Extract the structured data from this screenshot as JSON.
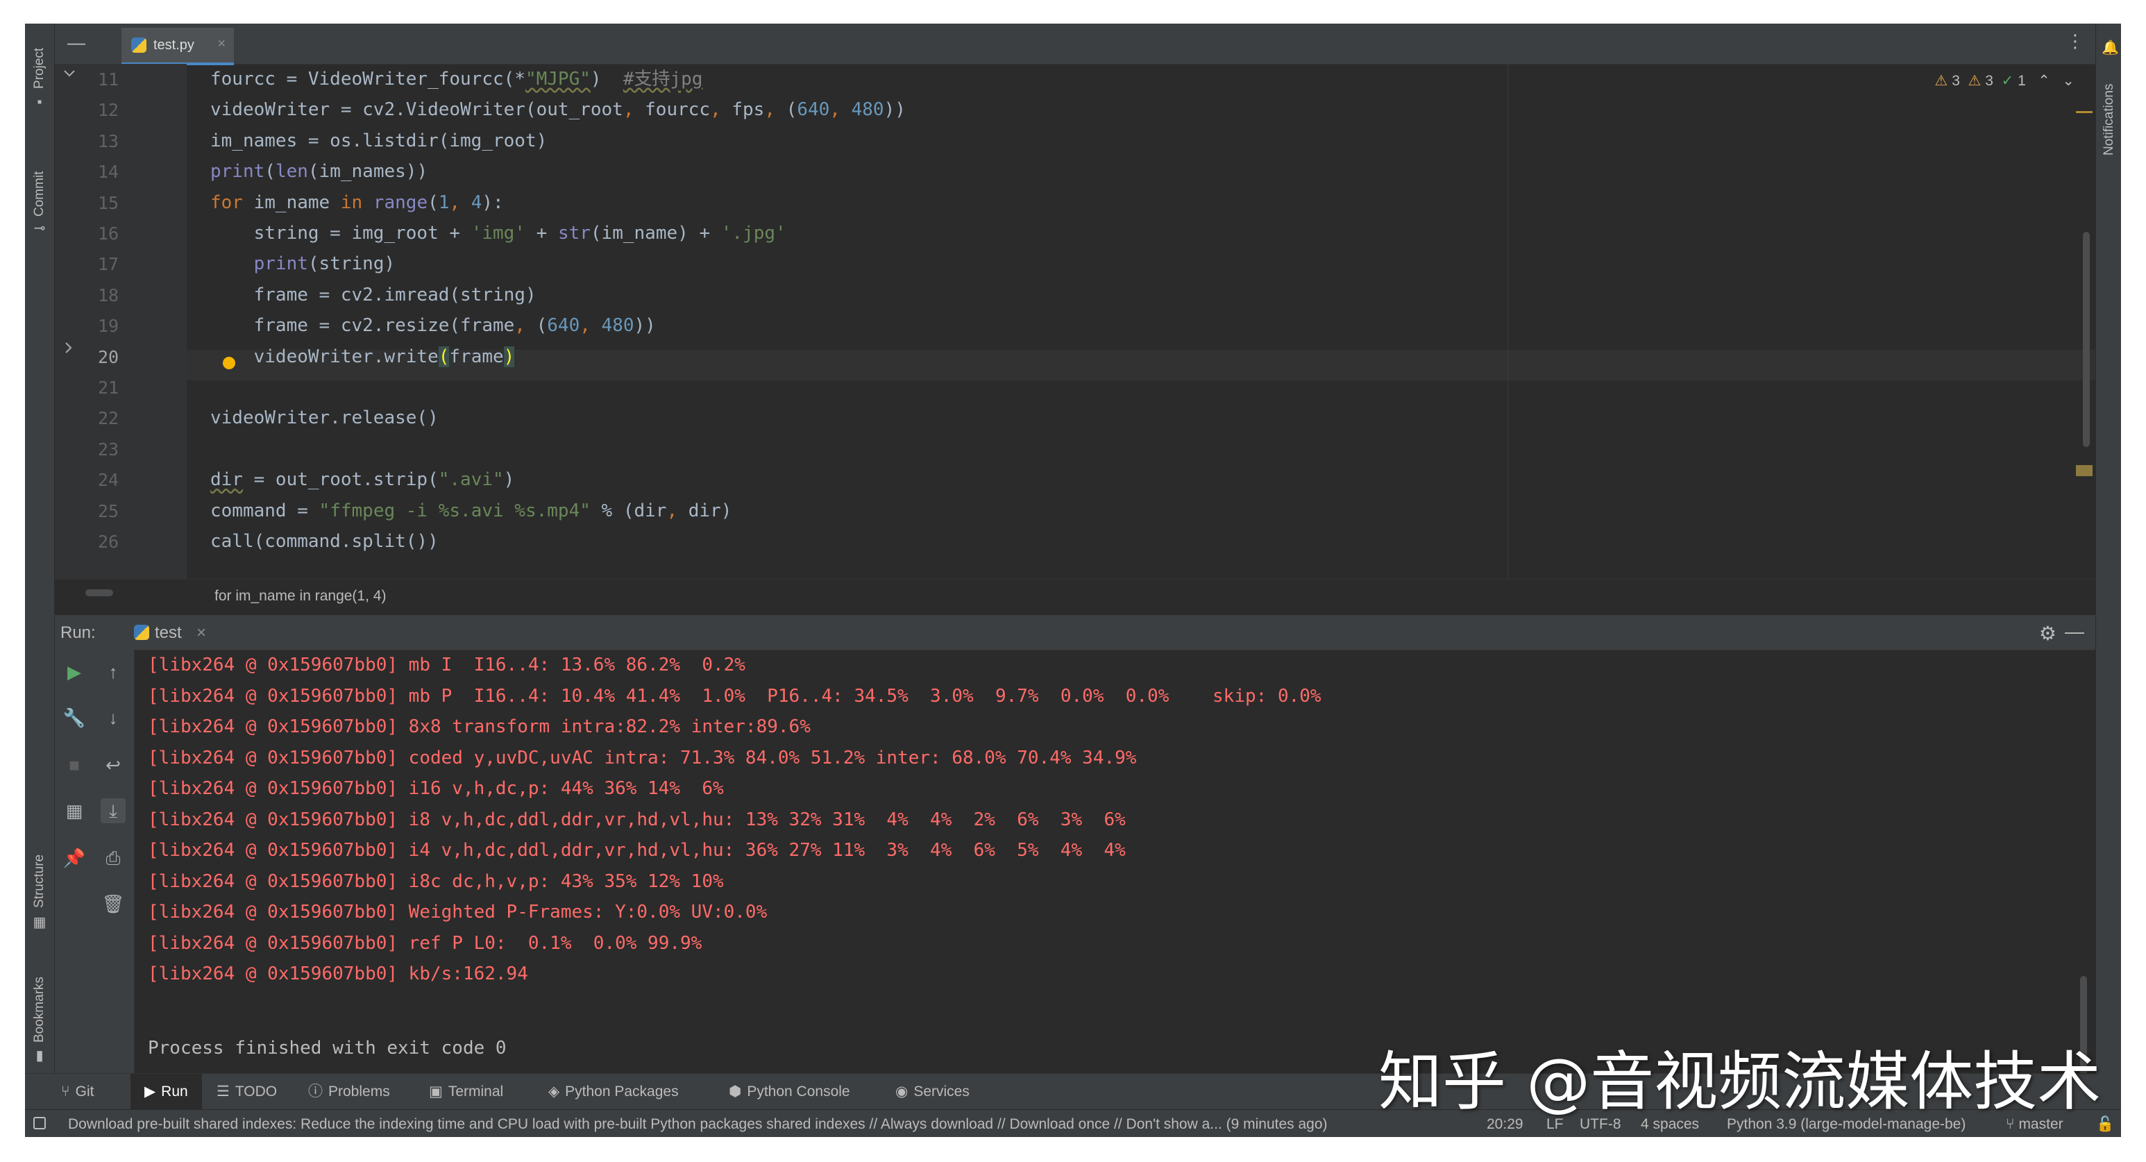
{
  "left_strip": {
    "project": "Project",
    "commit": "Commit",
    "structure": "Structure",
    "bookmarks": "Bookmarks"
  },
  "right_strip": {
    "notifications": "Notifications"
  },
  "editor": {
    "tab_label": "test.py",
    "inspections": {
      "warnings": "3",
      "weak_warnings": "3",
      "typos": "1"
    },
    "line_numbers": [
      "11",
      "12",
      "13",
      "14",
      "15",
      "16",
      "17",
      "18",
      "19",
      "20",
      "21",
      "22",
      "23",
      "24",
      "25",
      "26"
    ],
    "code_lines": [
      [
        [
          "plain",
          "fourcc = VideoWriter_fourcc(*"
        ],
        [
          "str und",
          "\"MJPG\""
        ],
        [
          "plain",
          ")  "
        ],
        [
          "cm und",
          "#支持jpg"
        ]
      ],
      [
        [
          "plain",
          "videoWriter = cv2.VideoWriter(out_root"
        ],
        [
          "kw",
          ", "
        ],
        [
          "plain",
          "fourcc"
        ],
        [
          "kw",
          ", "
        ],
        [
          "plain",
          "fps"
        ],
        [
          "kw",
          ", "
        ],
        [
          "plain",
          "("
        ],
        [
          "num",
          "640"
        ],
        [
          "kw",
          ", "
        ],
        [
          "num",
          "480"
        ],
        [
          "plain",
          "))"
        ]
      ],
      [
        [
          "plain",
          "im_names = os.listdir(img_root)"
        ]
      ],
      [
        [
          "bi",
          "print"
        ],
        [
          "plain",
          "("
        ],
        [
          "bi",
          "len"
        ],
        [
          "plain",
          "(im_names))"
        ]
      ],
      [
        [
          "kw",
          "for "
        ],
        [
          "plain",
          "im_name "
        ],
        [
          "kw",
          "in "
        ],
        [
          "bi",
          "range"
        ],
        [
          "plain",
          "("
        ],
        [
          "num",
          "1"
        ],
        [
          "kw",
          ", "
        ],
        [
          "num",
          "4"
        ],
        [
          "plain",
          "):"
        ]
      ],
      [
        [
          "plain",
          "    string = img_root + "
        ],
        [
          "str",
          "'img'"
        ],
        [
          "plain",
          " + "
        ],
        [
          "bi",
          "str"
        ],
        [
          "plain",
          "(im_name) + "
        ],
        [
          "str",
          "'.jpg'"
        ]
      ],
      [
        [
          "plain",
          "    "
        ],
        [
          "bi",
          "print"
        ],
        [
          "plain",
          "(string)"
        ]
      ],
      [
        [
          "plain",
          "    frame = cv2.imread(string)"
        ]
      ],
      [
        [
          "plain",
          "    frame = cv2.resize(frame"
        ],
        [
          "kw",
          ", "
        ],
        [
          "plain",
          "("
        ],
        [
          "num",
          "640"
        ],
        [
          "kw",
          ", "
        ],
        [
          "num",
          "480"
        ],
        [
          "plain",
          "))"
        ]
      ],
      [
        [
          "plain",
          "    videoWriter.write"
        ],
        [
          "match",
          "("
        ],
        [
          "plain",
          "frame"
        ],
        [
          "match",
          ")"
        ]
      ],
      [
        [
          "plain",
          ""
        ]
      ],
      [
        [
          "plain",
          "videoWriter.release()"
        ]
      ],
      [
        [
          "plain",
          ""
        ]
      ],
      [
        [
          "plain und",
          "dir"
        ],
        [
          "plain",
          " = out_root.strip("
        ],
        [
          "str",
          "\".avi\""
        ],
        [
          "plain",
          ")"
        ]
      ],
      [
        [
          "plain",
          "command = "
        ],
        [
          "str",
          "\"ffmpeg -i %s.avi %s.mp4\""
        ],
        [
          "plain",
          " % (dir"
        ],
        [
          "kw",
          ", "
        ],
        [
          "plain",
          "dir)"
        ]
      ],
      [
        [
          "plain",
          "call(command.split())"
        ]
      ]
    ],
    "breadcrumb": "for im_name in range(1, 4)"
  },
  "run": {
    "label": "Run:",
    "tab": "test",
    "console_lines": [
      "[libx264 @ 0x159607bb0] mb I  I16..4: 13.6% 86.2%  0.2%",
      "[libx264 @ 0x159607bb0] mb P  I16..4: 10.4% 41.4%  1.0%  P16..4: 34.5%  3.0%  9.7%  0.0%  0.0%    skip: 0.0%",
      "[libx264 @ 0x159607bb0] 8x8 transform intra:82.2% inter:89.6%",
      "[libx264 @ 0x159607bb0] coded y,uvDC,uvAC intra: 71.3% 84.0% 51.2% inter: 68.0% 70.4% 34.9%",
      "[libx264 @ 0x159607bb0] i16 v,h,dc,p: 44% 36% 14%  6%",
      "[libx264 @ 0x159607bb0] i8 v,h,dc,ddl,ddr,vr,hd,vl,hu: 13% 32% 31%  4%  4%  2%  6%  3%  6%",
      "[libx264 @ 0x159607bb0] i4 v,h,dc,ddl,ddr,vr,hd,vl,hu: 36% 27% 11%  3%  4%  6%  5%  4%  4%",
      "[libx264 @ 0x159607bb0] i8c dc,h,v,p: 43% 35% 12% 10%",
      "[libx264 @ 0x159607bb0] Weighted P-Frames: Y:0.0% UV:0.0%",
      "[libx264 @ 0x159607bb0] ref P L0:  0.1%  0.0% 99.9%",
      "[libx264 @ 0x159607bb0] kb/s:162.94"
    ],
    "finish": "Process finished with exit code 0"
  },
  "bottom_tabs": [
    {
      "name": "git",
      "label": "Git",
      "icon": "branch-icon"
    },
    {
      "name": "run",
      "label": "Run",
      "icon": "play-icon"
    },
    {
      "name": "todo",
      "label": "TODO",
      "icon": "list-icon"
    },
    {
      "name": "problems",
      "label": "Problems",
      "icon": "info-icon"
    },
    {
      "name": "terminal",
      "label": "Terminal",
      "icon": "terminal-icon"
    },
    {
      "name": "python-packages",
      "label": "Python Packages",
      "icon": "layers-icon"
    },
    {
      "name": "python-console",
      "label": "Python Console",
      "icon": "python-icon"
    },
    {
      "name": "services",
      "label": "Services",
      "icon": "services-icon"
    }
  ],
  "status": {
    "message": "Download pre-built shared indexes: Reduce the indexing time and CPU load with pre-built Python packages shared indexes // Always download // Download once // Don't show a... (9 minutes ago)",
    "position": "20:29",
    "line_sep": "LF",
    "encoding": "UTF-8",
    "indent": "4 spaces",
    "interpreter": "Python 3.9 (large-model-manage-be)",
    "branch": "master"
  },
  "watermark": "知乎 @音视频流媒体技术"
}
